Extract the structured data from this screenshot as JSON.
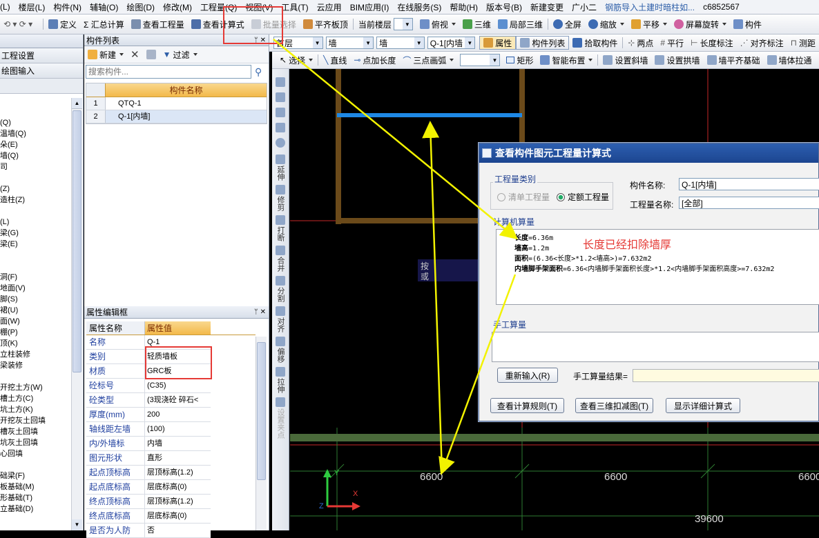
{
  "menu": [
    "(L)",
    "楼层(L)",
    "构件(N)",
    "辅轴(O)",
    "绘图(D)",
    "修改(M)",
    "工程量(Q)",
    "视图(V)",
    "工具(T)",
    "云应用",
    "BIM应用(I)",
    "在线服务(S)",
    "帮助(H)",
    "版本号(B)",
    "新建变更",
    "广小二",
    "钢筋导入土建时暗柱如...",
    "c6852567"
  ],
  "toolbar1": {
    "define": "定义",
    "sum": "Σ 汇总计算",
    "view_qty": "查看工程量",
    "view_formula": "查看计算式",
    "batch": "批量选择",
    "flat_slab": "平齐板顶",
    "floor_label": "当前楼层",
    "top_view": "俯视",
    "three_d": "三维",
    "local_3d": "局部三维",
    "fullscreen": "全屏",
    "zoom": "缩放",
    "pan": "平移",
    "rotate": "屏幕旋转",
    "component": "构件"
  },
  "left_nav": {
    "project_settings": "工程设置",
    "drawing_input": "绘图输入"
  },
  "tree_items": [
    "(Q)",
    "温墙(Q)",
    "朵(E)",
    "墙(Q)",
    "司",
    "",
    "(Z)",
    "造柱(Z)",
    "",
    "(L)",
    "梁(G)",
    "梁(E)",
    "",
    "",
    "洞(F)",
    "地面(V)",
    "脚(S)",
    "裙(U)",
    "面(W)",
    "棚(P)",
    "顶(K)",
    "立柱装修",
    "梁装修",
    "",
    "开挖土方(W)",
    "槽土方(C)",
    "坑土方(K)",
    "开挖灰土回填",
    "槽灰土回填",
    "坑灰土回填",
    "心回填",
    "",
    "础梁(F)",
    "板基础(M)",
    "形基础(T)",
    "立基础(D)"
  ],
  "component_list": {
    "title": "构件列表",
    "new": "新建",
    "filter": "过滤",
    "search_placeholder": "搜索构件...",
    "col_header": "构件名称",
    "rows": [
      {
        "idx": "1",
        "name": "QTQ-1"
      },
      {
        "idx": "2",
        "name": "Q-1[内墙]"
      }
    ]
  },
  "props": {
    "title": "属性编辑框",
    "col_name": "属性名称",
    "col_value": "属性值",
    "rows": [
      {
        "n": "名称",
        "v": "Q-1"
      },
      {
        "n": "类别",
        "v": "轻质墙板"
      },
      {
        "n": "材质",
        "v": "GRC板"
      },
      {
        "n": "砼标号",
        "v": "(C35)"
      },
      {
        "n": "砼类型",
        "v": "(3现浇砼 碎石<"
      },
      {
        "n": "厚度(mm)",
        "v": "200"
      },
      {
        "n": "轴线距左墙",
        "v": "(100)"
      },
      {
        "n": "内/外墙标",
        "v": "内墙"
      },
      {
        "n": "图元形状",
        "v": "直形"
      },
      {
        "n": "起点顶标高",
        "v": "层顶标高(1.2)"
      },
      {
        "n": "起点底标高",
        "v": "层底标高(0)"
      },
      {
        "n": "终点顶标高",
        "v": "层顶标高(1.2)"
      },
      {
        "n": "终点底标高",
        "v": "层底标高(0)"
      },
      {
        "n": "是否为人防",
        "v": "否"
      }
    ]
  },
  "toolbar2": {
    "floor": "首层",
    "type1": "墙",
    "type2": "墙",
    "comp": "Q-1[内墙",
    "attr": "属性",
    "comp_list": "构件列表",
    "pick": "拾取构件",
    "two_point": "两点",
    "parallel": "平行",
    "length_mark": "长度标注",
    "align_mark": "对齐标注",
    "measure": "测距"
  },
  "toolbar3": {
    "select": "选择",
    "line": "直线",
    "point_len": "点加长度",
    "arc": "三点画弧",
    "rect": "矩形",
    "smart": "智能布置",
    "slope_wall": "设置斜墙",
    "arch_wall": "设置拱墙",
    "wall_base": "墙平齐基础",
    "wall_pull": "墙体拉通"
  },
  "vtools": [
    "延伸",
    "修剪",
    "打断",
    "合并",
    "分割",
    "对齐",
    "偏移",
    "拉伸",
    "设置夹点"
  ],
  "canvas": {
    "dims": [
      "6600",
      "6600",
      "6600"
    ],
    "total": "39600",
    "hint1": "按",
    "hint2": "或"
  },
  "dialog": {
    "title": "查看构件图元工程量计算式",
    "qty_type": "工程量类别",
    "opt_list": "清单工程量",
    "opt_quota": "定额工程量",
    "comp_name_label": "构件名称:",
    "comp_name": "Q-1[内墙]",
    "qty_name_label": "工程量名称:",
    "qty_name": "[全部]",
    "computer_qty": "计算机算量",
    "lines": [
      {
        "k": "长度",
        "v": "=6.36m"
      },
      {
        "k": "墙高",
        "v": "=1.2m"
      },
      {
        "k": "面积",
        "v": "=(6.36<长度>*1.2<墙高>)=7.632m2"
      },
      {
        "k": "内墙脚手架面积",
        "v": "=6.36<内墙脚手架面积长度>*1.2<内墙脚手架面积高度>=7.632m2"
      }
    ],
    "annotation": "长度已经扣除墙厚",
    "manual_qty": "手工算量",
    "reinput": "重新输入(R)",
    "manual_result": "手工算量结果=",
    "btn_rules": "查看计算规则(T)",
    "btn_3d": "查看三维扣减图(T)",
    "btn_detail": "显示详细计算式"
  },
  "colors": {
    "highlight": "#e53935",
    "arrow": "#f2f200",
    "wall": "#6b4a1a",
    "beam": "#1e88e5",
    "grid_red": "#c62828",
    "grid_green": "#2e7d32"
  }
}
